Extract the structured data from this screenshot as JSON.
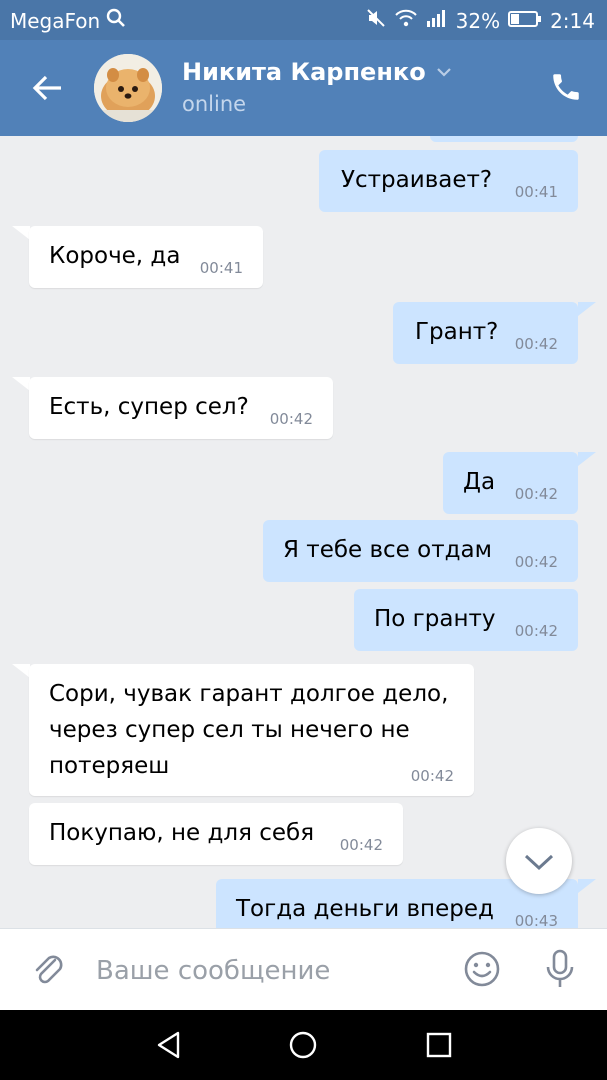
{
  "status_bar": {
    "carrier": "MegaFon",
    "battery": "32%",
    "time": "2:14",
    "icons": [
      "search-icon",
      "mute-icon",
      "wifi-icon",
      "signal-icon",
      "battery-icon"
    ]
  },
  "header": {
    "name": "Никита Карпенко",
    "status": "online",
    "icons": [
      "back-arrow-icon",
      "chevron-down-icon",
      "phone-icon"
    ]
  },
  "messages": [
    {
      "dir": "out",
      "text": "Устраивает?",
      "time": "00:41"
    },
    {
      "dir": "in",
      "text": "Короче, да",
      "time": "00:41"
    },
    {
      "dir": "out",
      "text": "Грант?",
      "time": "00:42"
    },
    {
      "dir": "in",
      "text": "Есть, супер сел?",
      "time": "00:42"
    },
    {
      "dir": "out",
      "text": "Да",
      "time": "00:42"
    },
    {
      "dir": "out",
      "text": "Я тебе все отдам",
      "time": "00:42"
    },
    {
      "dir": "out",
      "text": "По гранту",
      "time": "00:42"
    },
    {
      "dir": "in",
      "text": "Сори, чувак гарант долгое дело,\nчерез супер сел ты нечего не\nпотеряеш",
      "time": "00:42"
    },
    {
      "dir": "in",
      "text": "Покупаю, не для себя",
      "time": "00:42"
    },
    {
      "dir": "out",
      "text": "Тогда деньги вперед",
      "time": "00:43"
    }
  ],
  "composer": {
    "placeholder": "Ваше сообщение",
    "value": "",
    "icons": [
      "paperclip-icon",
      "emoji-icon",
      "microphone-icon"
    ]
  },
  "colors": {
    "header": "#5181b8",
    "status_bar": "#4a76a8",
    "incoming_bubble": "#ffffff",
    "outgoing_bubble": "#cce4ff",
    "chat_background": "#edeef0"
  }
}
